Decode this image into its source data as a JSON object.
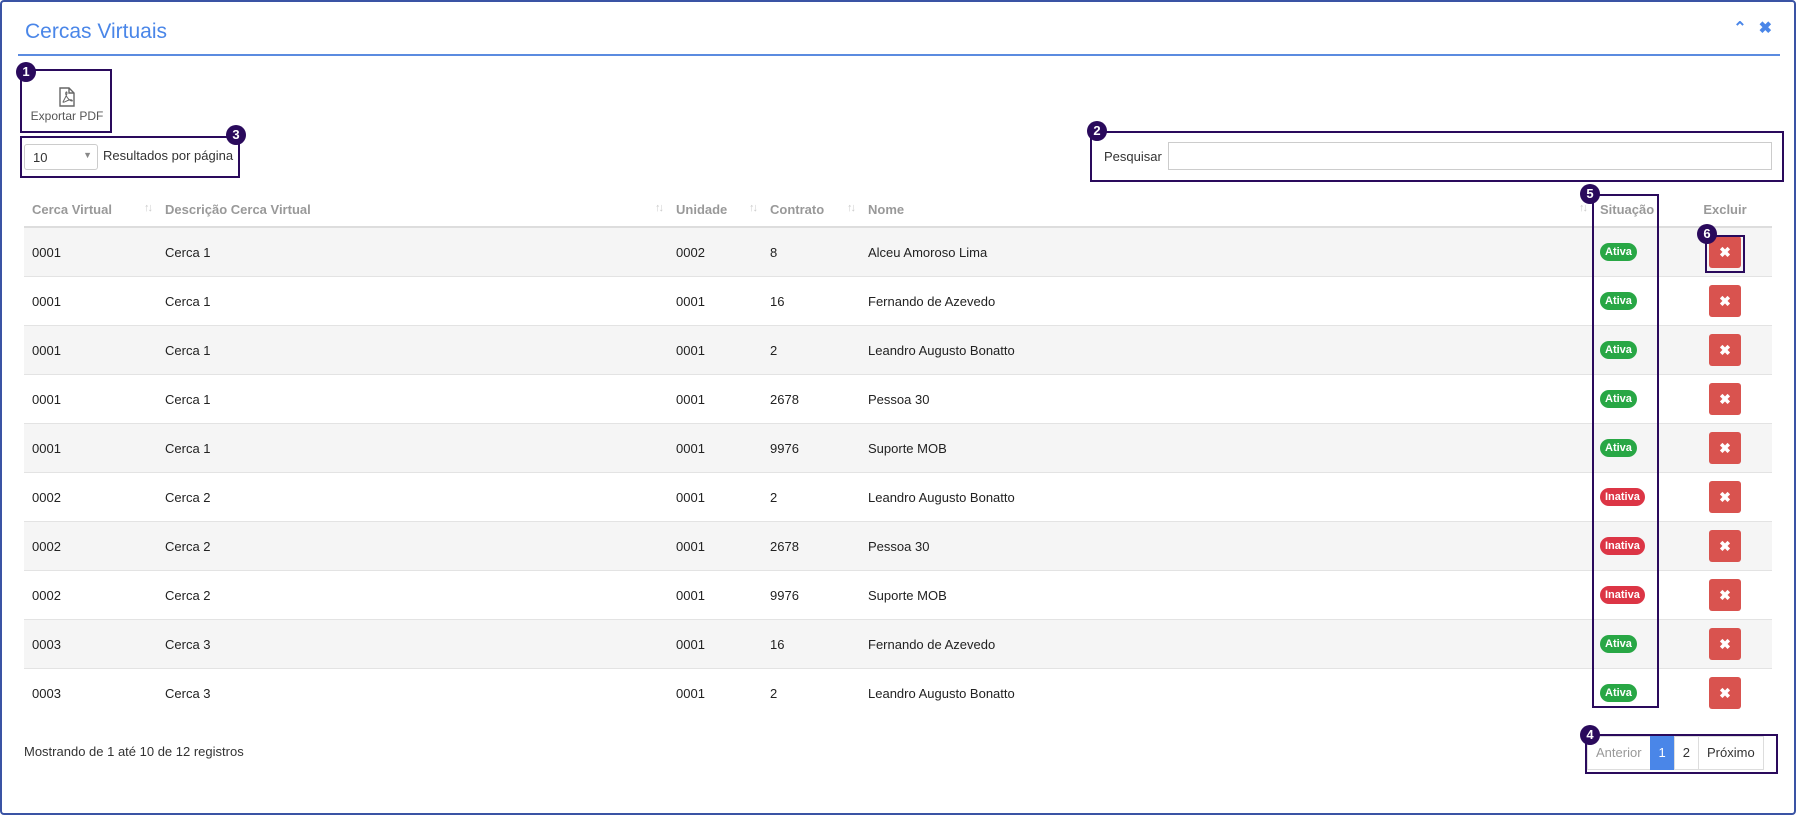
{
  "panel": {
    "title": "Cercas Virtuais",
    "collapse_icon": "chevron-up-icon",
    "close_icon": "close-icon"
  },
  "toolbar": {
    "export_label": "Exportar PDF",
    "export_icon": "pdf-file-icon"
  },
  "length": {
    "value": "10",
    "label": "Resultados por página"
  },
  "search": {
    "label": "Pesquisar",
    "value": "",
    "placeholder": ""
  },
  "table": {
    "headers": [
      "Cerca Virtual",
      "Descrição Cerca Virtual",
      "Unidade",
      "Contrato",
      "Nome",
      "Situação",
      "Excluir"
    ],
    "rows": [
      {
        "cerca": "0001",
        "descricao": "Cerca 1",
        "unidade": "0002",
        "contrato": "8",
        "nome": "Alceu Amoroso Lima",
        "situacao": "Ativa"
      },
      {
        "cerca": "0001",
        "descricao": "Cerca 1",
        "unidade": "0001",
        "contrato": "16",
        "nome": "Fernando de Azevedo",
        "situacao": "Ativa"
      },
      {
        "cerca": "0001",
        "descricao": "Cerca 1",
        "unidade": "0001",
        "contrato": "2",
        "nome": "Leandro Augusto Bonatto",
        "situacao": "Ativa"
      },
      {
        "cerca": "0001",
        "descricao": "Cerca 1",
        "unidade": "0001",
        "contrato": "2678",
        "nome": "Pessoa 30",
        "situacao": "Ativa"
      },
      {
        "cerca": "0001",
        "descricao": "Cerca 1",
        "unidade": "0001",
        "contrato": "9976",
        "nome": "Suporte MOB",
        "situacao": "Ativa"
      },
      {
        "cerca": "0002",
        "descricao": "Cerca 2",
        "unidade": "0001",
        "contrato": "2",
        "nome": "Leandro Augusto Bonatto",
        "situacao": "Inativa"
      },
      {
        "cerca": "0002",
        "descricao": "Cerca 2",
        "unidade": "0001",
        "contrato": "2678",
        "nome": "Pessoa 30",
        "situacao": "Inativa"
      },
      {
        "cerca": "0002",
        "descricao": "Cerca 2",
        "unidade": "0001",
        "contrato": "9976",
        "nome": "Suporte MOB",
        "situacao": "Inativa"
      },
      {
        "cerca": "0003",
        "descricao": "Cerca 3",
        "unidade": "0001",
        "contrato": "16",
        "nome": "Fernando de Azevedo",
        "situacao": "Ativa"
      },
      {
        "cerca": "0003",
        "descricao": "Cerca 3",
        "unidade": "0001",
        "contrato": "2",
        "nome": "Leandro Augusto Bonatto",
        "situacao": "Ativa"
      }
    ],
    "delete_icon": "close-icon"
  },
  "info": "Mostrando de 1 até 10 de 12 registros",
  "pagination": {
    "previous": "Anterior",
    "pages": [
      "1",
      "2"
    ],
    "current": "1",
    "next": "Próximo"
  },
  "annotations": [
    "1",
    "2",
    "3",
    "4",
    "5",
    "6"
  ],
  "colors": {
    "accent": "#4a86e8",
    "annotation": "#2a0a5c",
    "active": "#28a745",
    "inactive": "#dc3545",
    "delete": "#d9534f"
  }
}
